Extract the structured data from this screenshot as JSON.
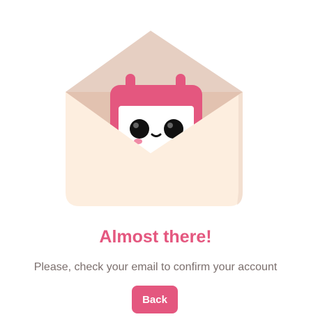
{
  "confirmation": {
    "title": "Almost there!",
    "message": "Please, check your email to confirm your account",
    "back_button_label": "Back"
  },
  "illustration": {
    "name": "envelope-calendar-mascot",
    "icons": [
      "envelope-icon",
      "calendar-mascot-icon"
    ]
  },
  "colors": {
    "accent": "#e4577f",
    "envelope_body": "#fdeedf",
    "envelope_flap": "#e6cfc2",
    "text_muted": "#7b6f6d",
    "background": "#ffffff"
  }
}
